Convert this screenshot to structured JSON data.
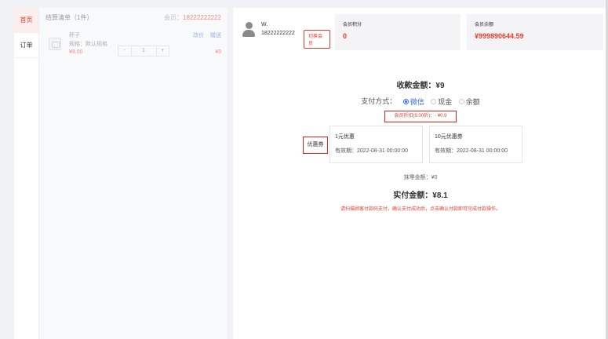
{
  "nav": {
    "items": [
      {
        "label": "首页",
        "active": true
      },
      {
        "label": "订单",
        "active": false
      }
    ]
  },
  "cart": {
    "title": "结算清单（1件）",
    "member_label": "会员：",
    "member_phone": "18222222222",
    "item": {
      "name": "杯子",
      "spec": "规格：默认规格",
      "price": "¥9.00",
      "quantity": "1",
      "minus": "-",
      "plus": "+",
      "subtotal": "¥9",
      "actions": [
        "改价",
        "赠送"
      ]
    }
  },
  "member": {
    "name": "W.",
    "phone": "18222222222",
    "cancel_label": "切换会员"
  },
  "stats": {
    "points_label": "会员积分",
    "points_value": "0",
    "balance_label": "会员余额",
    "balance_value": "¥999890644.59"
  },
  "payment": {
    "amount_title": "收款金额：¥9",
    "method_label": "支付方式：",
    "methods": [
      {
        "label": "微信",
        "checked": true
      },
      {
        "label": "现金",
        "checked": false
      },
      {
        "label": "余额",
        "checked": false
      }
    ],
    "discount_text": "会员折扣(9.00折)：- ¥0.9",
    "coupon_label": "优惠券",
    "coupons": [
      {
        "name": "1元优惠",
        "valid": "有效期：2022-08-31 00:00:00"
      },
      {
        "name": "10元优惠券",
        "valid": "有效期：2022-08-31 00:00:00"
      }
    ],
    "erase_text": "抹零金额：¥0",
    "paid_text": "实付金额：¥8.1",
    "hint_text": "请扫描顾客付款码支付，确认支付成功后，点击确认付款即可完成付款操作。"
  },
  "colors": {
    "accent_red": "#e63c2e",
    "selected_blue": "#2f6fe4",
    "highlight_box": "#d9241a"
  }
}
